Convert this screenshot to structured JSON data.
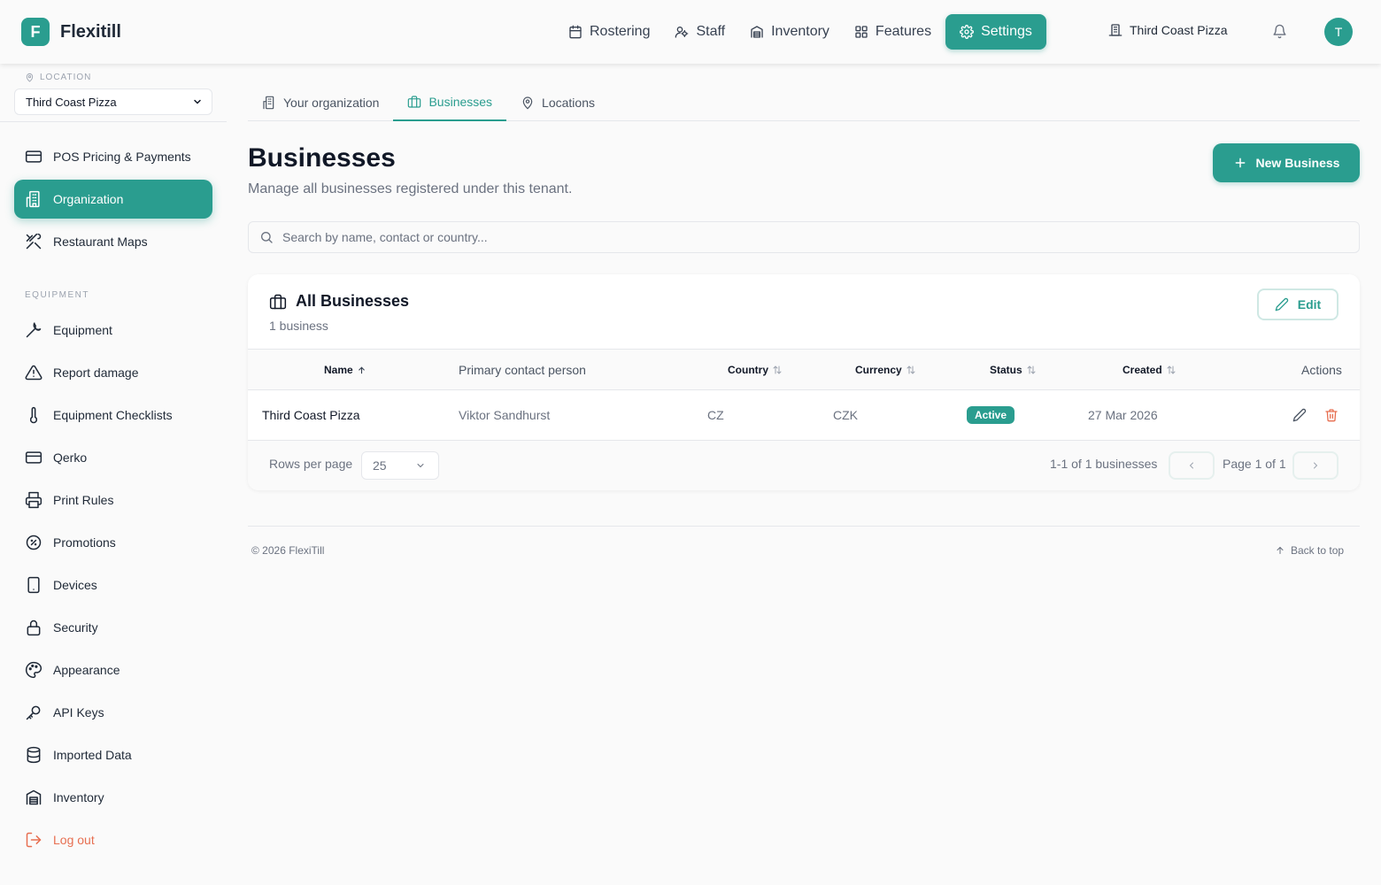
{
  "app": {
    "logo_letter": "F",
    "name": "Flexitill"
  },
  "topnav": {
    "items": [
      {
        "label": "Rostering",
        "icon": "calendar-icon"
      },
      {
        "label": "Staff",
        "icon": "users-icon"
      },
      {
        "label": "Inventory",
        "icon": "warehouse-icon"
      },
      {
        "label": "Features",
        "icon": "grid-icon"
      },
      {
        "label": "Settings",
        "icon": "gear-icon",
        "active": true
      }
    ],
    "org_name": "Third Coast Pizza",
    "avatar_letter": "T"
  },
  "sidebar": {
    "location_label": "LOCATION",
    "location_value": "Third Coast Pizza",
    "items": [
      {
        "label": "POS Pricing & Payments"
      },
      {
        "label": "Organization",
        "active": true
      },
      {
        "label": "Restaurant Maps"
      }
    ],
    "section_equipment": "EQUIPMENT",
    "equipment_items": [
      {
        "label": "Equipment"
      },
      {
        "label": "Report damage"
      },
      {
        "label": "Equipment Checklists"
      },
      {
        "label": "Qerko"
      },
      {
        "label": "Print Rules"
      },
      {
        "label": "Promotions"
      },
      {
        "label": "Devices"
      },
      {
        "label": "Security"
      },
      {
        "label": "Appearance"
      },
      {
        "label": "API Keys"
      },
      {
        "label": "Imported Data"
      },
      {
        "label": "Inventory"
      }
    ],
    "logout_label": "Log out"
  },
  "tabs": [
    {
      "label": "Your organization"
    },
    {
      "label": "Businesses",
      "active": true
    },
    {
      "label": "Locations"
    }
  ],
  "page": {
    "title": "Businesses",
    "subtitle": "Manage all businesses registered under this tenant.",
    "new_button": "New Business",
    "search_placeholder": "Search by name, contact or country..."
  },
  "card": {
    "title": "All Businesses",
    "count": "1 business",
    "edit_label": "Edit",
    "columns": {
      "name": "Name",
      "contact": "Primary contact person",
      "country": "Country",
      "currency": "Currency",
      "status": "Status",
      "created": "Created",
      "actions": "Actions"
    },
    "rows": [
      {
        "name": "Third Coast Pizza",
        "contact": "Viktor Sandhurst",
        "country": "CZ",
        "currency": "CZK",
        "status": "Active",
        "created": "27 Mar 2026"
      }
    ],
    "rows_per_page_label": "Rows per page",
    "rows_per_page_value": "25",
    "range_text": "1-1 of 1 businesses",
    "page_text": "Page 1 of 1"
  },
  "footer": {
    "copyright": "© 2026 FlexiTill",
    "back_to_top": "Back to top"
  },
  "colors": {
    "accent": "#2a9d8f",
    "danger": "#e76f51",
    "text": "#1f2937",
    "muted": "#6b7280"
  }
}
